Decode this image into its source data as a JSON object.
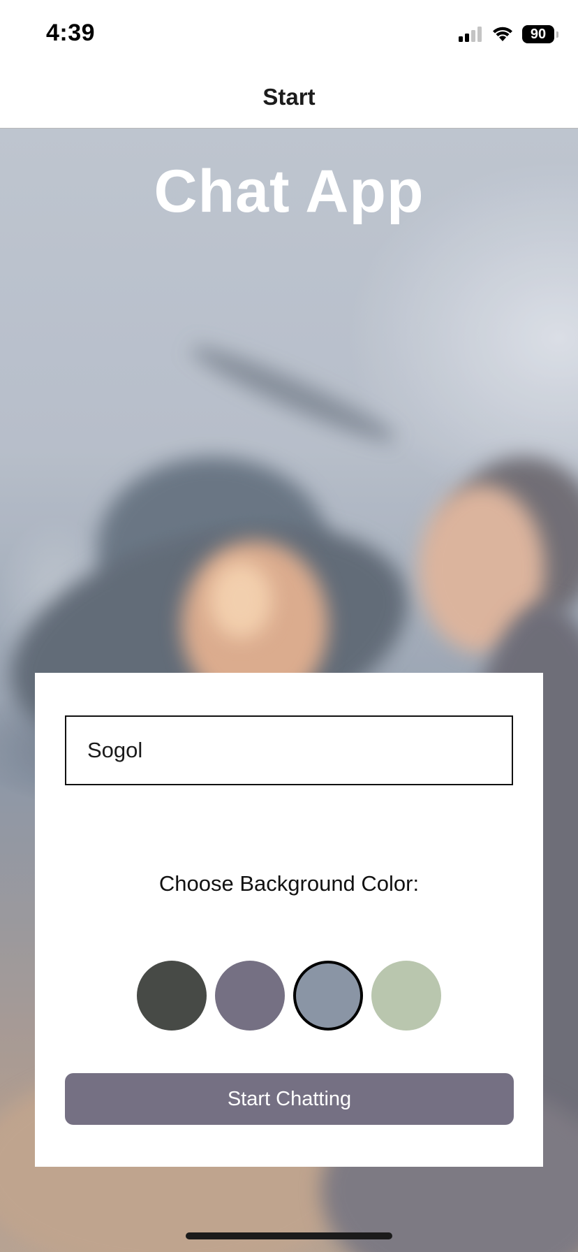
{
  "status_bar": {
    "time": "4:39",
    "battery_level": "90",
    "icons": [
      "cellular-signal-icon",
      "wifi-icon",
      "battery-icon"
    ]
  },
  "nav": {
    "title": "Start"
  },
  "main": {
    "app_title": "Chat App",
    "name_input": {
      "value": "Sogol",
      "placeholder": ""
    },
    "color_label": "Choose Background Color:",
    "colors": [
      {
        "hex": "#474a46",
        "selected": false
      },
      {
        "hex": "#757083",
        "selected": false
      },
      {
        "hex": "#8a95a5",
        "selected": true
      },
      {
        "hex": "#b9c6ae",
        "selected": false
      }
    ],
    "start_button_label": "Start Chatting"
  },
  "theme": {
    "button_color": "#757083",
    "panel_color": "#ffffff",
    "title_color": "#ffffff"
  }
}
